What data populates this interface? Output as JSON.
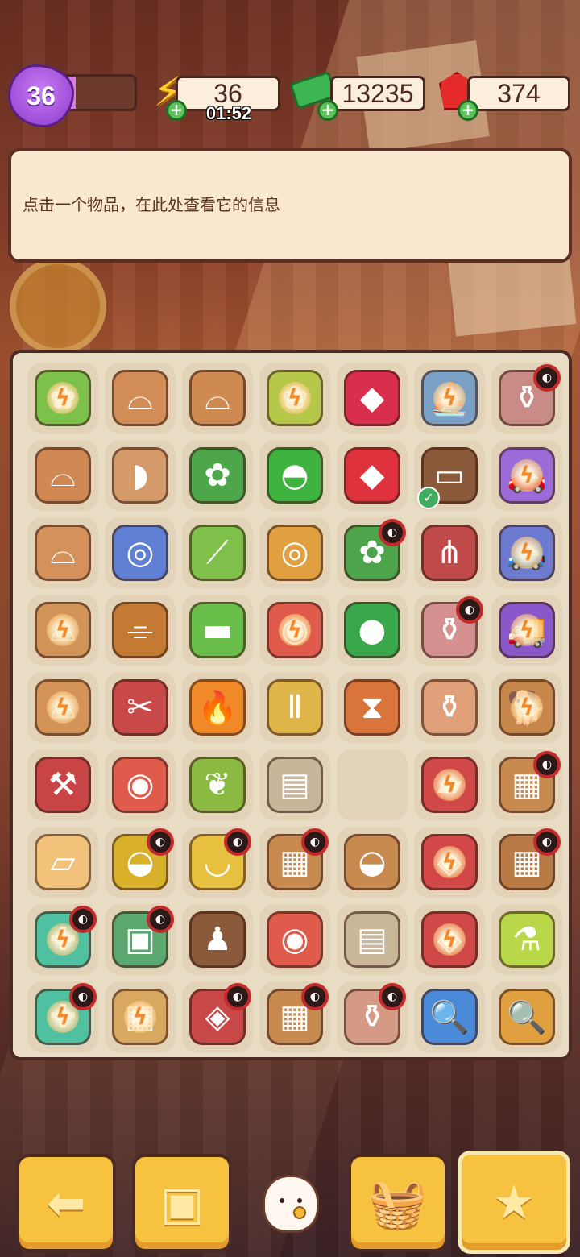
{
  "hud": {
    "level": "36",
    "level_progress_pct": 30,
    "energy": "36",
    "energy_timer": "01:52",
    "cash": "13235",
    "gems": "374",
    "icons": {
      "level": "star-badge-icon",
      "energy": "lightning-icon",
      "cash": "cash-stack-icon",
      "gems": "ruby-icon",
      "add": "plus-icon"
    }
  },
  "info_panel": {
    "text": "点击一个物品，在此处查看它的信息"
  },
  "board": {
    "rows": [
      [
        {
          "name": "flower-pot-seed-bag",
          "color": "#7cc14a",
          "glyph": "✿",
          "bolt": true
        },
        {
          "name": "broken-clay-pot",
          "color": "#d18d55",
          "glyph": "⌓"
        },
        {
          "name": "cracked-clay-pot",
          "color": "#cf8a52",
          "glyph": "⌓"
        },
        {
          "name": "seed-sack",
          "color": "#b6c84a",
          "glyph": "❀",
          "bolt": true
        },
        {
          "name": "ruby-basket",
          "color": "#d92f4d",
          "glyph": "◆"
        },
        {
          "name": "toy-boat",
          "color": "#7aa0c6",
          "glyph": "⛵",
          "bolt": true
        },
        {
          "name": "vase",
          "color": "#c98b86",
          "glyph": "⚱",
          "locked": true
        }
      ],
      [
        {
          "name": "clay-pot",
          "color": "#d08953",
          "glyph": "⌓"
        },
        {
          "name": "pot-shard",
          "color": "#d59a6a",
          "glyph": "◗"
        },
        {
          "name": "flower-bed",
          "color": "#4da64a",
          "glyph": "✿"
        },
        {
          "name": "green-cloth",
          "color": "#3fb33f",
          "glyph": "◓"
        },
        {
          "name": "rubies",
          "color": "#e0323d",
          "glyph": "◆"
        },
        {
          "name": "photo-frames",
          "color": "#8a5a3a",
          "glyph": "▭",
          "checked": true
        },
        {
          "name": "toy-car",
          "color": "#9b6bd8",
          "glyph": "🚗",
          "bolt": true
        }
      ],
      [
        {
          "name": "large-clay-pot",
          "color": "#d4915a",
          "glyph": "⌓"
        },
        {
          "name": "sunglasses",
          "color": "#5e7fd3",
          "glyph": "◎"
        },
        {
          "name": "shoe-horn-grass",
          "color": "#7fc04a",
          "glyph": "⟋"
        },
        {
          "name": "round-glasses",
          "color": "#e0a040",
          "glyph": "◎"
        },
        {
          "name": "flower-garden",
          "color": "#4ea44a",
          "glyph": "✿",
          "locked": true
        },
        {
          "name": "garden-fork",
          "color": "#c04a4a",
          "glyph": "⋔"
        },
        {
          "name": "jeep",
          "color": "#6c7ad0",
          "glyph": "🚙",
          "bolt": true
        }
      ],
      [
        {
          "name": "pot-seed-bag",
          "color": "#d39458",
          "glyph": "⌓",
          "bolt": true
        },
        {
          "name": "spyglass",
          "color": "#c47a33",
          "glyph": "⌯"
        },
        {
          "name": "moss-stone",
          "color": "#6abe4a",
          "glyph": "▬"
        },
        {
          "name": "dragon-snow-globe",
          "color": "#e05b4b",
          "glyph": "◉",
          "bolt": true
        },
        {
          "name": "green-sponge",
          "color": "#39a84a",
          "glyph": "●"
        },
        {
          "name": "tall-vase",
          "color": "#d59090",
          "glyph": "⚱",
          "locked": true
        },
        {
          "name": "toy-truck",
          "color": "#8a58c8",
          "glyph": "🚚",
          "bolt": true
        }
      ],
      [
        {
          "name": "pot-seeds",
          "color": "#d49457",
          "glyph": "⌓",
          "bolt": true
        },
        {
          "name": "pruning-shears",
          "color": "#c94848",
          "glyph": "✂"
        },
        {
          "name": "fire-brazier",
          "color": "#f08a28",
          "glyph": "🔥"
        },
        {
          "name": "column-pedestal",
          "color": "#e0b54a",
          "glyph": "Ⅱ"
        },
        {
          "name": "hourglass",
          "color": "#d9743a",
          "glyph": "⧗"
        },
        {
          "name": "bottle-vase",
          "color": "#e0a07a",
          "glyph": "⚱"
        },
        {
          "name": "police-dog",
          "color": "#c8874a",
          "glyph": "🐕",
          "bolt": true
        }
      ],
      [
        {
          "name": "garden-trowel",
          "color": "#c94545",
          "glyph": "⚒"
        },
        {
          "name": "dragon-globe",
          "color": "#e05b4b",
          "glyph": "◉"
        },
        {
          "name": "sprout",
          "color": "#8aba42",
          "glyph": "❦"
        },
        {
          "name": "seed-packet",
          "color": "#c8b59a",
          "glyph": "▤"
        },
        {
          "name": "empty",
          "empty": true
        },
        {
          "name": "sofa-seat",
          "color": "#d04848",
          "glyph": "▰",
          "bolt": true
        },
        {
          "name": "crate-pots",
          "color": "#c98a50",
          "glyph": "▦",
          "locked": true
        }
      ],
      [
        {
          "name": "toast-slices",
          "color": "#f2c27a",
          "glyph": "▱"
        },
        {
          "name": "cauldron",
          "color": "#d9b02a",
          "glyph": "◒",
          "locked": true
        },
        {
          "name": "bathtub",
          "color": "#e8c040",
          "glyph": "◡",
          "locked": true
        },
        {
          "name": "wood-crate",
          "color": "#c98a50",
          "glyph": "▦",
          "locked": true
        },
        {
          "name": "bread-bowl",
          "color": "#c98a50",
          "glyph": "◒"
        },
        {
          "name": "red-robot",
          "color": "#d24848",
          "glyph": "◈",
          "bolt": true
        },
        {
          "name": "shipping-crate",
          "color": "#b97a45",
          "glyph": "▦",
          "locked": true
        }
      ],
      [
        {
          "name": "first-aid-kit",
          "color": "#4fc0a0",
          "glyph": "✚",
          "bolt": true,
          "locked": true
        },
        {
          "name": "display-case",
          "color": "#5aa870",
          "glyph": "▣",
          "locked": true
        },
        {
          "name": "chess-pawn",
          "color": "#8a5a3a",
          "glyph": "♟"
        },
        {
          "name": "dragon-snow-globe",
          "color": "#e05b4b",
          "glyph": "◉"
        },
        {
          "name": "evidence-bag",
          "color": "#c9b79a",
          "glyph": "▤"
        },
        {
          "name": "broken-gadget",
          "color": "#d04848",
          "glyph": "◈",
          "bolt": true
        },
        {
          "name": "soap-bottle",
          "color": "#b8d84a",
          "glyph": "⚗"
        }
      ],
      [
        {
          "name": "medicine-kit",
          "color": "#4fc0a0",
          "glyph": "✚",
          "bolt": true,
          "locked": true
        },
        {
          "name": "taped-box",
          "color": "#d9a860",
          "glyph": "▦",
          "bolt": true
        },
        {
          "name": "robot-parts",
          "color": "#c84848",
          "glyph": "◈",
          "locked": true
        },
        {
          "name": "crate-jars",
          "color": "#c98a50",
          "glyph": "▦",
          "locked": true
        },
        {
          "name": "striped-vase",
          "color": "#d59a86",
          "glyph": "⚱",
          "locked": true
        },
        {
          "name": "blue-magnifier",
          "color": "#4a8ad8",
          "glyph": "🔍"
        },
        {
          "name": "gold-magnifier",
          "color": "#e0a040",
          "glyph": "🔍"
        }
      ]
    ]
  },
  "nav": {
    "back_icon": "back-arrow-icon",
    "bag_icon": "backpack-icon",
    "cat_icon": "lucky-cat-icon",
    "basket_icon": "basket-icon",
    "clipboard_icon": "clipboard-star-icon"
  }
}
